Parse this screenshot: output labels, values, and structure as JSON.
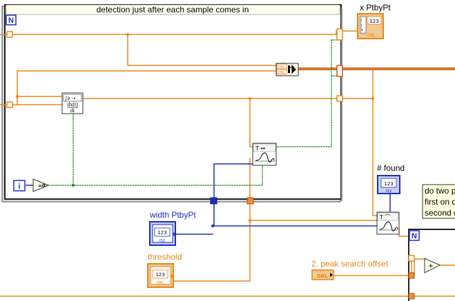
{
  "loop": {
    "title": "detection just after each sample comes in",
    "n_label": "N",
    "iteration_label": "i",
    "compare_label": "=0"
  },
  "terminals": {
    "x_ptbypt": {
      "label": "x PtbyPt",
      "value": "123",
      "type": "DBL"
    },
    "found": {
      "label": "# found",
      "value": "123",
      "type": "I32"
    },
    "width_ptbypt": {
      "label": "width PtbyPt",
      "value": "123",
      "type": "I32"
    },
    "threshold": {
      "label": "threshold",
      "value": "123",
      "type": "DBL"
    },
    "peak_search_offset": {
      "label": "2. peak search offset",
      "type": "DBL"
    }
  },
  "nodes": {
    "derivative": {
      "line1": "dx(t)",
      "line2": "dt"
    },
    "build_array_tag": "DBL",
    "plus": "+"
  },
  "comment": {
    "lines": [
      "do two p",
      "first on d",
      "second c"
    ]
  },
  "colors": {
    "dbl_wire": "#e8861a",
    "int_wire": "#1a2ebf",
    "bool_wire": "#1a8a1a",
    "array_wire": "#c65a12",
    "frame_border": "#303030"
  }
}
